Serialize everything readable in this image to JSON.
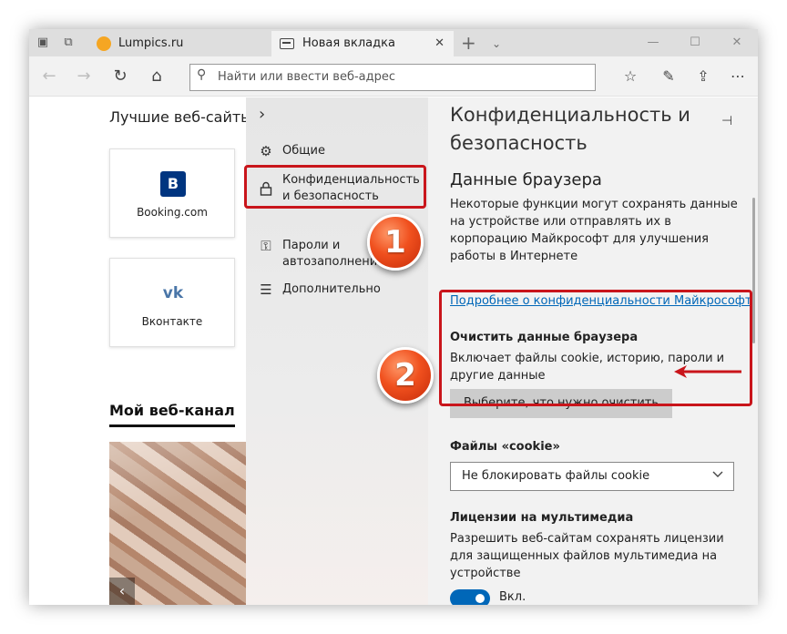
{
  "browser": {
    "tabs": [
      {
        "label": "Lumpics.ru",
        "favicon": "lumpics-orange-favicon",
        "active": false
      },
      {
        "label": "Новая вкладка",
        "favicon": "new-tab-favicon",
        "active": true
      }
    ],
    "tab_close_glyph": "✕",
    "new_tab_glyph": "+",
    "tab_menu_glyph": "⌄",
    "window_controls": {
      "minimize": "—",
      "maximize": "☐",
      "close": "✕"
    },
    "address_placeholder": "Найти или ввести веб-адрес",
    "nav_glyphs": {
      "back": "←",
      "forward": "→",
      "refresh": "↻",
      "home": "⌂",
      "search": "⚲"
    },
    "toolbar_glyphs": {
      "favorites": "☆",
      "notes": "✎",
      "share": "⇪",
      "more": "⋯"
    }
  },
  "new_tab_page": {
    "top_sites_title": "Лучшие веб-сайты",
    "tiles": [
      {
        "name": "Booking.com",
        "logo_letter": "B",
        "color": "#003580"
      },
      {
        "name": "Вконтакте",
        "logo_letter": "vk",
        "color": "#4a76a8"
      }
    ],
    "feed_title": "Мой веб-канал",
    "feed_prev_glyph": "‹"
  },
  "settings_nav": {
    "collapse_glyph": "›",
    "items": [
      {
        "icon": "gear-icon",
        "glyph": "⚙",
        "label": "Общие"
      },
      {
        "icon": "lock-icon",
        "glyph": "🔒",
        "label": "Конфиденциальность и безопасность"
      },
      {
        "icon": "key-icon",
        "glyph": "⚿",
        "label": "Пароли и автозаполнение"
      },
      {
        "icon": "sliders-icon",
        "glyph": "☰",
        "label": "Дополнительно"
      }
    ]
  },
  "settings_panel": {
    "title": "Конфиденциальность и безопасность",
    "pin_glyph": "⊣",
    "browser_data_heading": "Данные браузера",
    "browser_data_desc": "Некоторые функции могут сохранять данные на устройстве или отправлять их в корпорацию Майкрософт для улучшения работы в Интернете",
    "privacy_link": "Подробнее о конфиденциальности Майкрософт",
    "clear_heading": "Очистить данные браузера",
    "clear_desc": "Включает файлы cookie, историю, пароли и другие данные",
    "clear_button": "Выберите, что нужно очистить",
    "cookies_heading": "Файлы «cookie»",
    "cookies_value": "Не блокировать файлы cookie",
    "media_heading": "Лицензии на мультимедиа",
    "media_desc": "Разрешить веб-сайтам сохранять лицензии для защищенных файлов мультимедиа на устройстве",
    "media_toggle_label": "Вкл.",
    "media_toggle_on": true
  },
  "annotations": {
    "badge1": "1",
    "badge2": "2",
    "highlight_color": "#c9151b",
    "badge_color": "#f0501e"
  }
}
